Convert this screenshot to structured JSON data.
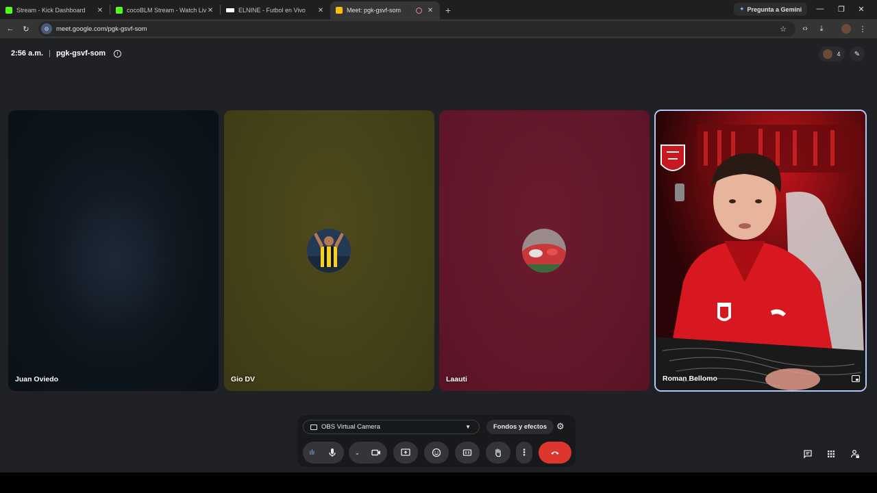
{
  "browser": {
    "tabs": [
      {
        "title": "Stream - Kick Dashboard",
        "favicon_color": "#53fc18"
      },
      {
        "title": "cocoBLM Stream - Watch Live o",
        "favicon_color": "#53fc18"
      },
      {
        "title": "ELNINE - Futbol en Vivo",
        "favicon_color": "#ffffff"
      },
      {
        "title": "Meet: pgk-gsvf-som",
        "favicon_color": "#fbbc04"
      }
    ],
    "gemini_label": "Pregunta a Gemini",
    "url": "meet.google.com/pgk-gsvf-som"
  },
  "meet": {
    "time": "2:56 a.m.",
    "separator": "|",
    "meeting_code": "pgk-gsvf-som",
    "participant_count": "4",
    "participants": [
      {
        "name": "Juan Oviedo",
        "background": "#0d151c"
      },
      {
        "name": "Gio DV",
        "background": "#423f18"
      },
      {
        "name": "Laauti",
        "background": "#611629"
      },
      {
        "name": "Roman Bellomo",
        "background": "#1a0a0a"
      }
    ],
    "camera_select": "OBS Virtual Camera",
    "effects_button": "Fondos y efectos"
  },
  "colors": {
    "hangup": "#dc362e",
    "active_speaker_border": "#aecbfa",
    "meet_background": "#202124"
  }
}
